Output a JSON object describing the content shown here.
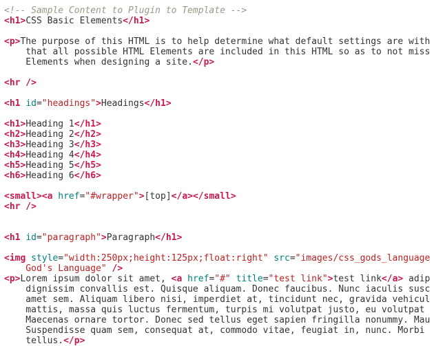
{
  "colors": {
    "comment": "#999988",
    "tag": "#c9184a",
    "attr": "#008080",
    "string": "#bd2121",
    "text": "#333333",
    "bg": "#ffffff"
  },
  "lines": [
    {
      "parts": [
        {
          "c": "comment",
          "t": "<!-- Sample Content to Plugin to Template -->"
        }
      ]
    },
    {
      "parts": [
        {
          "c": "tag",
          "t": "<h1>"
        },
        {
          "c": "text",
          "t": "CSS Basic Elements"
        },
        {
          "c": "tag",
          "t": "</h1>"
        }
      ]
    },
    {
      "parts": []
    },
    {
      "parts": [
        {
          "c": "tag",
          "t": "<p>"
        },
        {
          "c": "text",
          "t": "The purpose of this HTML is to help determine what default settings are with"
        }
      ]
    },
    {
      "parts": [
        {
          "c": "text",
          "t": "    that all possible HTML Elements are included in this HTML so as to not miss"
        }
      ]
    },
    {
      "parts": [
        {
          "c": "text",
          "t": "    Elements when designing a site."
        },
        {
          "c": "tag",
          "t": "</p>"
        }
      ]
    },
    {
      "parts": []
    },
    {
      "parts": [
        {
          "c": "tag",
          "t": "<hr />"
        }
      ]
    },
    {
      "parts": []
    },
    {
      "parts": [
        {
          "c": "tag",
          "t": "<h1"
        },
        {
          "c": "text",
          "t": " "
        },
        {
          "c": "attr",
          "t": "id"
        },
        {
          "c": "punct",
          "t": "="
        },
        {
          "c": "str",
          "t": "\"headings\""
        },
        {
          "c": "tag",
          "t": ">"
        },
        {
          "c": "text",
          "t": "Headings"
        },
        {
          "c": "tag",
          "t": "</h1>"
        }
      ]
    },
    {
      "parts": []
    },
    {
      "parts": [
        {
          "c": "tag",
          "t": "<h1>"
        },
        {
          "c": "text",
          "t": "Heading 1"
        },
        {
          "c": "tag",
          "t": "</h1>"
        }
      ]
    },
    {
      "parts": [
        {
          "c": "tag",
          "t": "<h2>"
        },
        {
          "c": "text",
          "t": "Heading 2"
        },
        {
          "c": "tag",
          "t": "</h2>"
        }
      ]
    },
    {
      "parts": [
        {
          "c": "tag",
          "t": "<h3>"
        },
        {
          "c": "text",
          "t": "Heading 3"
        },
        {
          "c": "tag",
          "t": "</h3>"
        }
      ]
    },
    {
      "parts": [
        {
          "c": "tag",
          "t": "<h4>"
        },
        {
          "c": "text",
          "t": "Heading 4"
        },
        {
          "c": "tag",
          "t": "</h4>"
        }
      ]
    },
    {
      "parts": [
        {
          "c": "tag",
          "t": "<h5>"
        },
        {
          "c": "text",
          "t": "Heading 5"
        },
        {
          "c": "tag",
          "t": "</h5>"
        }
      ]
    },
    {
      "parts": [
        {
          "c": "tag",
          "t": "<h6>"
        },
        {
          "c": "text",
          "t": "Heading 6"
        },
        {
          "c": "tag",
          "t": "</h6>"
        }
      ]
    },
    {
      "parts": []
    },
    {
      "parts": [
        {
          "c": "tag",
          "t": "<small>"
        },
        {
          "c": "tag",
          "t": "<a"
        },
        {
          "c": "text",
          "t": " "
        },
        {
          "c": "attr",
          "t": "href"
        },
        {
          "c": "punct",
          "t": "="
        },
        {
          "c": "str",
          "t": "\"#wrapper\""
        },
        {
          "c": "tag",
          "t": ">"
        },
        {
          "c": "text",
          "t": "[top]"
        },
        {
          "c": "tag",
          "t": "</a>"
        },
        {
          "c": "tag",
          "t": "</small>"
        }
      ]
    },
    {
      "parts": [
        {
          "c": "tag",
          "t": "<hr />"
        }
      ]
    },
    {
      "parts": []
    },
    {
      "parts": []
    },
    {
      "parts": [
        {
          "c": "tag",
          "t": "<h1"
        },
        {
          "c": "text",
          "t": " "
        },
        {
          "c": "attr",
          "t": "id"
        },
        {
          "c": "punct",
          "t": "="
        },
        {
          "c": "str",
          "t": "\"paragraph\""
        },
        {
          "c": "tag",
          "t": ">"
        },
        {
          "c": "text",
          "t": "Paragraph"
        },
        {
          "c": "tag",
          "t": "</h1>"
        }
      ]
    },
    {
      "parts": []
    },
    {
      "parts": [
        {
          "c": "tag",
          "t": "<img"
        },
        {
          "c": "text",
          "t": " "
        },
        {
          "c": "attr",
          "t": "style"
        },
        {
          "c": "punct",
          "t": "="
        },
        {
          "c": "str",
          "t": "\"width:250px;height:125px;float:right\""
        },
        {
          "c": "text",
          "t": " "
        },
        {
          "c": "attr",
          "t": "src"
        },
        {
          "c": "punct",
          "t": "="
        },
        {
          "c": "str",
          "t": "\"images/css_gods_language"
        }
      ]
    },
    {
      "parts": [
        {
          "c": "str",
          "t": "    God's Language\""
        },
        {
          "c": "text",
          "t": " "
        },
        {
          "c": "tag",
          "t": "/>"
        }
      ]
    },
    {
      "parts": [
        {
          "c": "tag",
          "t": "<p>"
        },
        {
          "c": "text",
          "t": "Lorem ipsum dolor sit amet, "
        },
        {
          "c": "tag",
          "t": "<a"
        },
        {
          "c": "text",
          "t": " "
        },
        {
          "c": "attr",
          "t": "href"
        },
        {
          "c": "punct",
          "t": "="
        },
        {
          "c": "str",
          "t": "\"#\""
        },
        {
          "c": "text",
          "t": " "
        },
        {
          "c": "attr",
          "t": "title"
        },
        {
          "c": "punct",
          "t": "="
        },
        {
          "c": "str",
          "t": "\"test link\""
        },
        {
          "c": "tag",
          "t": ">"
        },
        {
          "c": "text",
          "t": "test link"
        },
        {
          "c": "tag",
          "t": "</a>"
        },
        {
          "c": "text",
          "t": " adip"
        }
      ]
    },
    {
      "parts": [
        {
          "c": "text",
          "t": "    dignissim convallis est. Quisque aliquam. Donec faucibus. Nunc iaculis susc"
        }
      ]
    },
    {
      "parts": [
        {
          "c": "text",
          "t": "    amet sem. Aliquam libero nisi, imperdiet at, tincidunt nec, gravida vehicul"
        }
      ]
    },
    {
      "parts": [
        {
          "c": "text",
          "t": "    mattis, massa quis luctus fermentum, turpis mi volutpat justo, eu volutpat "
        }
      ]
    },
    {
      "parts": [
        {
          "c": "text",
          "t": "    Maecenas ornare tortor. Donec sed tellus eget sapien fringilla nonummy. Mau"
        }
      ]
    },
    {
      "parts": [
        {
          "c": "text",
          "t": "    Suspendisse quam sem, consequat at, commodo vitae, feugiat in, nunc. Morbi "
        }
      ]
    },
    {
      "parts": [
        {
          "c": "text",
          "t": "    tellus."
        },
        {
          "c": "tag",
          "t": "</p>"
        }
      ]
    }
  ]
}
